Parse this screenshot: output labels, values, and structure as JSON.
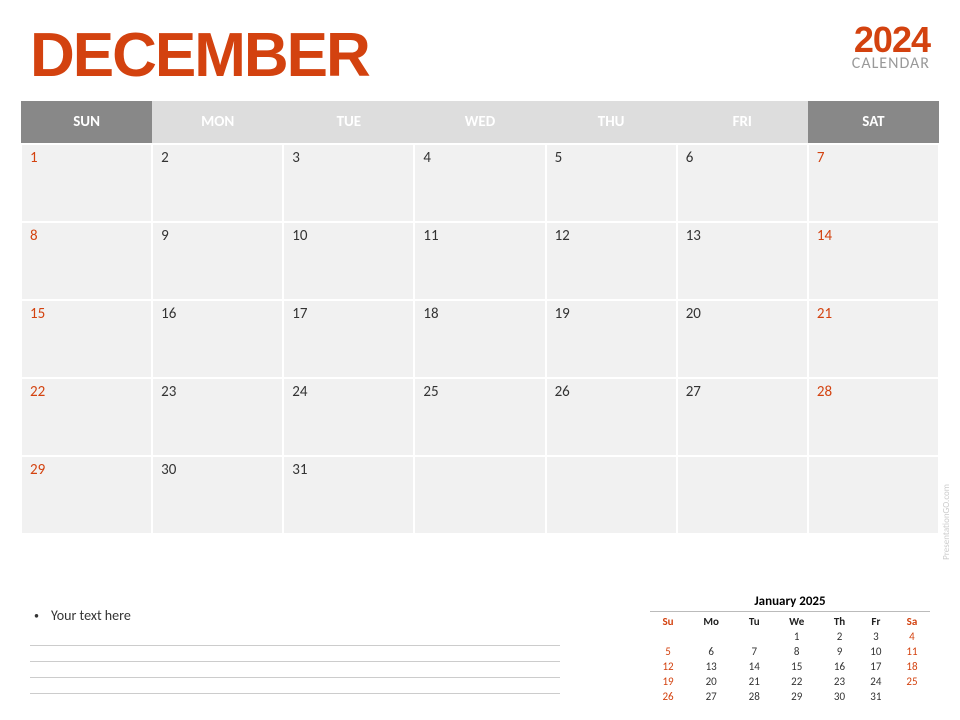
{
  "header": {
    "month": "DECEMBER",
    "year": "2024",
    "label": "CALENDAR"
  },
  "weekdays": [
    "SUN",
    "MON",
    "TUE",
    "WED",
    "THU",
    "FRI",
    "SAT"
  ],
  "weeks": [
    [
      {
        "d": "1",
        "w": true
      },
      {
        "d": "2"
      },
      {
        "d": "3"
      },
      {
        "d": "4"
      },
      {
        "d": "5"
      },
      {
        "d": "6"
      },
      {
        "d": "7",
        "w": true
      }
    ],
    [
      {
        "d": "8",
        "w": true
      },
      {
        "d": "9"
      },
      {
        "d": "10"
      },
      {
        "d": "11"
      },
      {
        "d": "12"
      },
      {
        "d": "13"
      },
      {
        "d": "14",
        "w": true
      }
    ],
    [
      {
        "d": "15",
        "w": true
      },
      {
        "d": "16"
      },
      {
        "d": "17"
      },
      {
        "d": "18"
      },
      {
        "d": "19"
      },
      {
        "d": "20"
      },
      {
        "d": "21",
        "w": true
      }
    ],
    [
      {
        "d": "22",
        "w": true
      },
      {
        "d": "23"
      },
      {
        "d": "24"
      },
      {
        "d": "25"
      },
      {
        "d": "26"
      },
      {
        "d": "27"
      },
      {
        "d": "28",
        "w": true
      }
    ],
    [
      {
        "d": "29",
        "w": true
      },
      {
        "d": "30"
      },
      {
        "d": "31"
      },
      {
        "d": ""
      },
      {
        "d": ""
      },
      {
        "d": ""
      },
      {
        "d": ""
      }
    ]
  ],
  "notes": {
    "placeholder": "Your text here"
  },
  "mini": {
    "title": "January 2025",
    "head": [
      "Su",
      "Mo",
      "Tu",
      "We",
      "Th",
      "Fr",
      "Sa"
    ],
    "rows": [
      [
        {
          "d": ""
        },
        {
          "d": ""
        },
        {
          "d": ""
        },
        {
          "d": "1"
        },
        {
          "d": "2"
        },
        {
          "d": "3"
        },
        {
          "d": "4",
          "w": true
        }
      ],
      [
        {
          "d": "5",
          "w": true
        },
        {
          "d": "6"
        },
        {
          "d": "7"
        },
        {
          "d": "8"
        },
        {
          "d": "9"
        },
        {
          "d": "10"
        },
        {
          "d": "11",
          "w": true
        }
      ],
      [
        {
          "d": "12",
          "w": true
        },
        {
          "d": "13"
        },
        {
          "d": "14"
        },
        {
          "d": "15"
        },
        {
          "d": "16"
        },
        {
          "d": "17"
        },
        {
          "d": "18",
          "w": true
        }
      ],
      [
        {
          "d": "19",
          "w": true
        },
        {
          "d": "20"
        },
        {
          "d": "21"
        },
        {
          "d": "22"
        },
        {
          "d": "23"
        },
        {
          "d": "24"
        },
        {
          "d": "25",
          "w": true
        }
      ],
      [
        {
          "d": "26",
          "w": true
        },
        {
          "d": "27"
        },
        {
          "d": "28"
        },
        {
          "d": "29"
        },
        {
          "d": "30"
        },
        {
          "d": "31"
        },
        {
          "d": ""
        }
      ]
    ]
  },
  "watermark": "PresentationGO.com"
}
